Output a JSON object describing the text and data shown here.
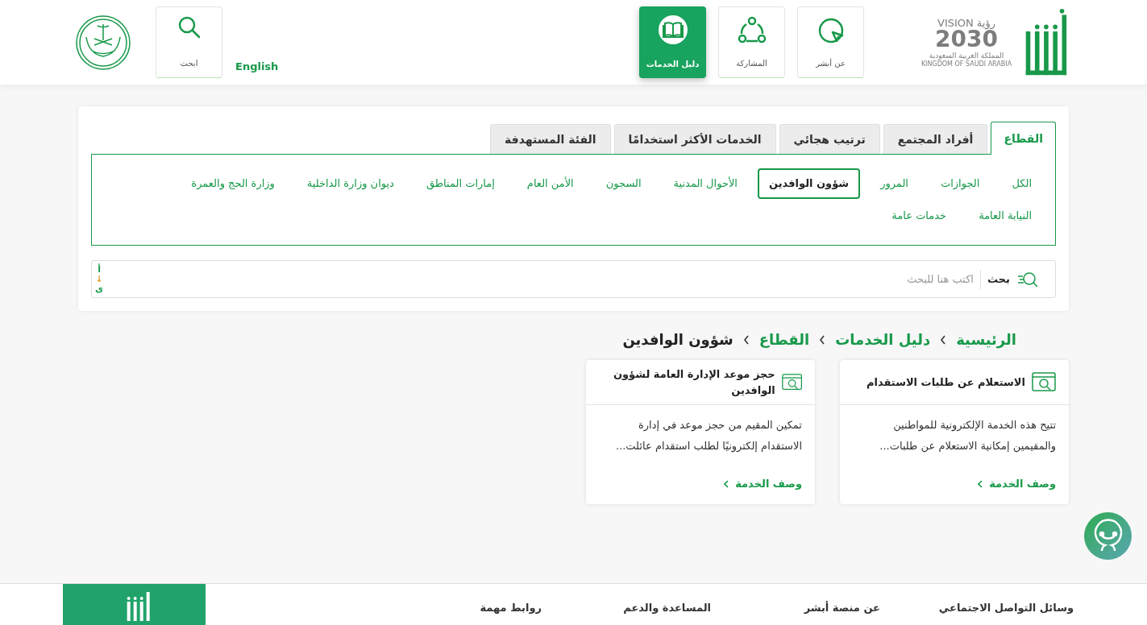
{
  "header": {
    "vision_logo": {
      "word_en": "VISION",
      "word_ar": "رؤية",
      "year": "2030",
      "country_ar": "المملكة العربية السعودية",
      "country_en": "KINGDOM OF SAUDI ARABIA"
    },
    "nav": [
      {
        "kind": "pointer",
        "label": "عن أبشر",
        "selected": false
      },
      {
        "kind": "share",
        "label": "المشاركة",
        "selected": false
      },
      {
        "kind": "book",
        "label": "دليل الخدمات",
        "selected": true
      }
    ],
    "language": "English",
    "search_button": "ابحث"
  },
  "filter_card": {
    "tabs": [
      {
        "label": "القطاع",
        "selected": true
      },
      {
        "label": "أفراد المجتمع",
        "selected": false
      },
      {
        "label": "ترتيب هجائي",
        "selected": false
      },
      {
        "label": "الخدمات الأكثر استخدامًا",
        "selected": false
      },
      {
        "label": "الفئة المستهدفة",
        "selected": false
      }
    ],
    "sectors": [
      {
        "label": "الكل",
        "selected": false
      },
      {
        "label": "الجوازات",
        "selected": false
      },
      {
        "label": "المرور",
        "selected": false
      },
      {
        "label": "شؤون الوافدين",
        "selected": true
      },
      {
        "label": "الأحوال المدنية",
        "selected": false
      },
      {
        "label": "السجون",
        "selected": false
      },
      {
        "label": "الأمن العام",
        "selected": false
      },
      {
        "label": "إمارات المناطق",
        "selected": false
      },
      {
        "label": "ديوان وزارة الداخلية",
        "selected": false
      },
      {
        "label": "وزارة الحج والعمرة",
        "selected": false
      },
      {
        "label": "النيابة العامة",
        "selected": false
      },
      {
        "label": "خدمات عامة",
        "selected": false
      }
    ],
    "search": {
      "label": "بحث",
      "placeholder": "اكتب هنا للبحث",
      "sort_letters": [
        "أ",
        "↓",
        "ى"
      ]
    }
  },
  "breadcrumb": [
    "الرئيسية",
    "دليل الخدمات",
    "القطاع",
    "شؤون الوافدين"
  ],
  "services": [
    {
      "title": "الاستعلام عن طلبات الاستقدام",
      "description": "تتيح هذه الخدمة الإلكترونية للمواطنين والمقيمين إمكانية الاستعلام عن طلبات...",
      "link": "وصف الخدمة"
    },
    {
      "title": "حجز موعد الإدارة العامة لشؤون الوافدين",
      "description": "تمكين المقيم من حجز موعد في إدارة الاستقدام إلكترونيًا لطلب استقدام عائلت...",
      "link": "وصف الخدمة"
    }
  ],
  "footer": [
    "وسائل التواصل الاجتماعي",
    "عن منصة أبشر",
    "المساعدة والدعم",
    "روابط مهمة"
  ]
}
